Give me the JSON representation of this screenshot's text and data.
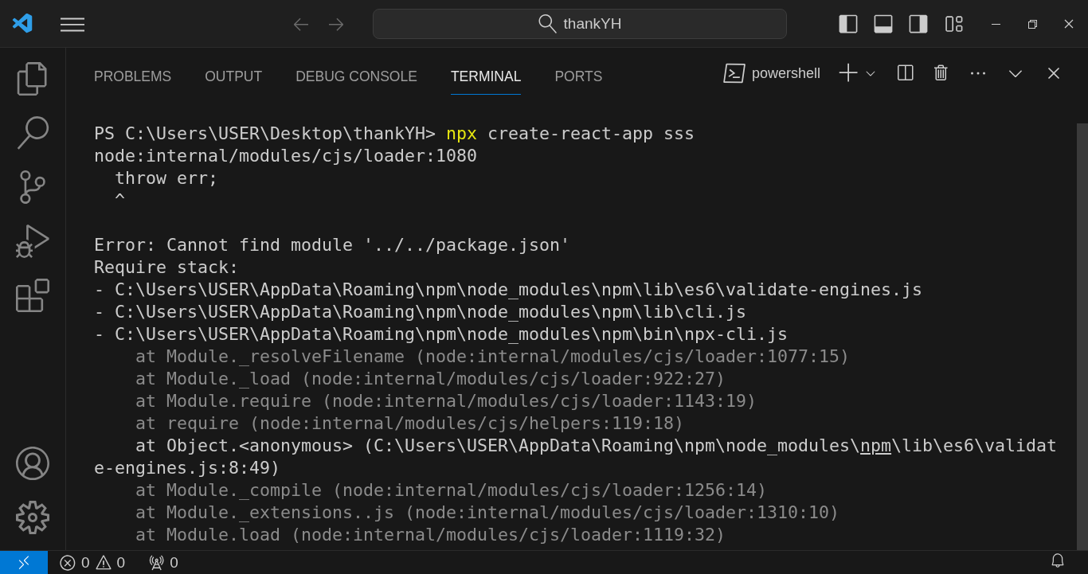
{
  "title_bar": {
    "search": "thankYH"
  },
  "panel": {
    "tabs": [
      {
        "label": "PROBLEMS",
        "selected": false
      },
      {
        "label": "OUTPUT",
        "selected": false
      },
      {
        "label": "DEBUG CONSOLE",
        "selected": false
      },
      {
        "label": "TERMINAL",
        "selected": true
      },
      {
        "label": "PORTS",
        "selected": false
      }
    ],
    "terminal_name": "powershell"
  },
  "terminal": [
    {
      "kind": "prompt",
      "prompt": "PS C:\\Users\\USER\\Desktop\\thankYH> ",
      "command": "npx",
      "args": " create-react-app sss"
    },
    {
      "kind": "normal",
      "text": "node:internal/modules/cjs/loader:1080"
    },
    {
      "kind": "normal",
      "text": "  throw err;"
    },
    {
      "kind": "normal",
      "text": "  ^"
    },
    {
      "kind": "blank"
    },
    {
      "kind": "normal",
      "text": "Error: Cannot find module '../../package.json'"
    },
    {
      "kind": "normal",
      "text": "Require stack:"
    },
    {
      "kind": "normal",
      "text": "- C:\\Users\\USER\\AppData\\Roaming\\npm\\node_modules\\npm\\lib\\es6\\validate-engines.js"
    },
    {
      "kind": "normal",
      "text": "- C:\\Users\\USER\\AppData\\Roaming\\npm\\node_modules\\npm\\lib\\cli.js"
    },
    {
      "kind": "normal",
      "text": "- C:\\Users\\USER\\AppData\\Roaming\\npm\\node_modules\\npm\\bin\\npx-cli.js"
    },
    {
      "kind": "dim",
      "text": "    at Module._resolveFilename (node:internal/modules/cjs/loader:1077:15)"
    },
    {
      "kind": "dim",
      "text": "    at Module._load (node:internal/modules/cjs/loader:922:27)"
    },
    {
      "kind": "dim",
      "text": "    at Module.require (node:internal/modules/cjs/loader:1143:19)"
    },
    {
      "kind": "dim",
      "text": "    at require (node:internal/modules/cjs/helpers:119:18)"
    },
    {
      "kind": "link",
      "before": "    at Object.<anonymous> (C:\\Users\\USER\\AppData\\Roaming\\npm\\node_modules\\",
      "link": "npm",
      "after": "\\lib\\es6\\validat"
    },
    {
      "kind": "normal",
      "text": "e-engines.js:8:49)"
    },
    {
      "kind": "dim",
      "text": "    at Module._compile (node:internal/modules/cjs/loader:1256:14)"
    },
    {
      "kind": "dim",
      "text": "    at Module._extensions..js (node:internal/modules/cjs/loader:1310:10)"
    },
    {
      "kind": "dim",
      "text": "    at Module.load (node:internal/modules/cjs/loader:1119:32)"
    }
  ],
  "status_bar": {
    "errors": "0",
    "warnings": "0",
    "ports": "0"
  }
}
